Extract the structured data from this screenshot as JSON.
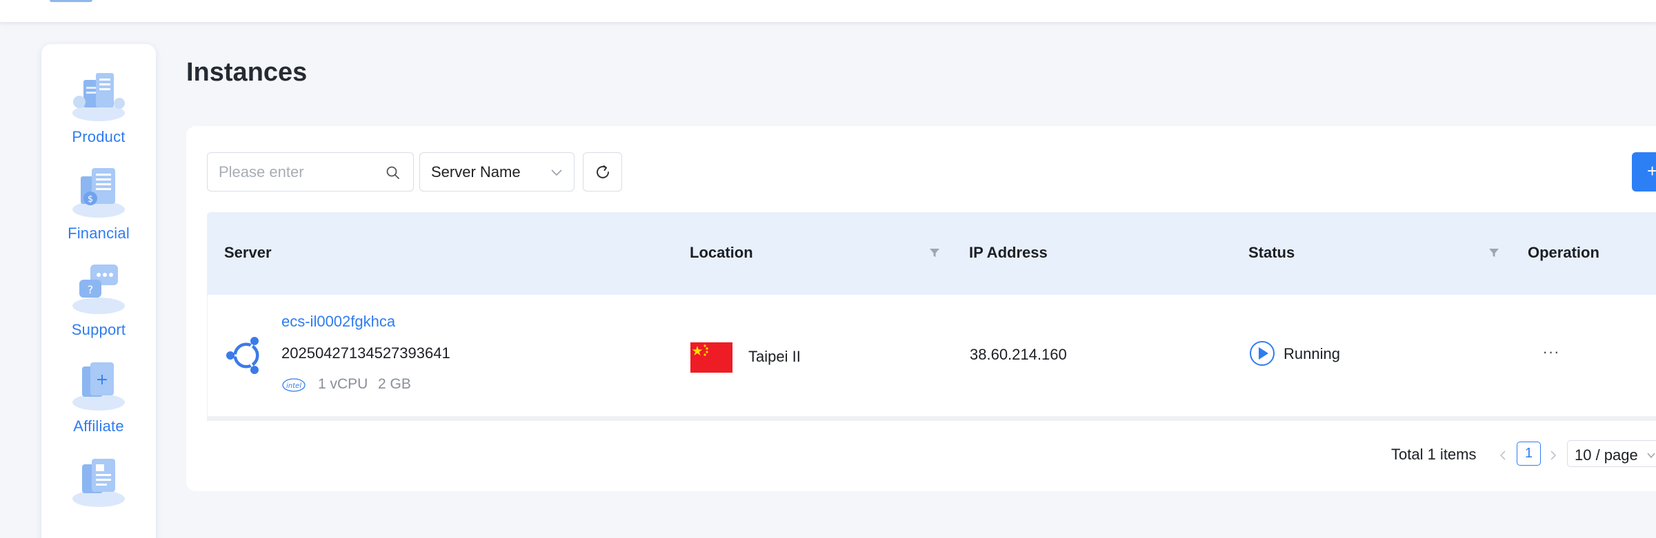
{
  "app": {
    "page_title": "Instances"
  },
  "sidebar": {
    "items": [
      {
        "label": "Product",
        "icon": "product-illustration-icon"
      },
      {
        "label": "Financial",
        "icon": "financial-illustration-icon"
      },
      {
        "label": "Support",
        "icon": "support-illustration-icon"
      },
      {
        "label": "Affiliate",
        "icon": "affiliate-illustration-icon"
      },
      {
        "label": "",
        "icon": "document-illustration-icon"
      }
    ]
  },
  "toolbar": {
    "search_placeholder": "Please enter",
    "search_value": "",
    "filter_field": "Server Name",
    "refresh_icon": "refresh-icon",
    "add_label": "+"
  },
  "table": {
    "columns": [
      "Server",
      "Location",
      "IP Address",
      "Status",
      "Operation"
    ],
    "rows": [
      {
        "name": "ecs-il0002fgkhca",
        "id": "20250427134527393641",
        "os_icon": "ubuntu-icon",
        "cpu_brand_icon": "intel-icon",
        "vcpu": "1 vCPU",
        "memory": "2 GB",
        "flag": "china-flag-icon",
        "location": "Taipei II",
        "ip": "38.60.214.160",
        "status": "Running",
        "operation": "···"
      }
    ]
  },
  "pagination": {
    "total": "Total 1 items",
    "current_page": "1",
    "page_size": "10 / page"
  },
  "colors": {
    "accent": "#2f7cf0",
    "header_bg": "#e8f0fc",
    "page_bg": "#f4f6fa",
    "flag_red": "#ee1c25",
    "flag_star": "#ffde00"
  }
}
